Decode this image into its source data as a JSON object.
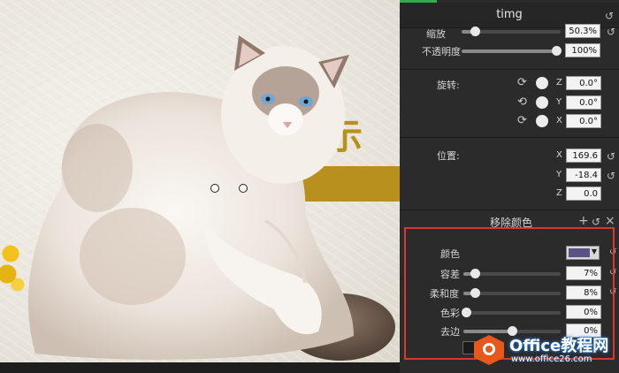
{
  "panel": {
    "title": "timg",
    "scale": {
      "label": "缩放",
      "value": "50.3%",
      "level": 0.2
    },
    "opacity": {
      "label": "不透明度",
      "value": "100%",
      "level": 1.0
    },
    "rotation": {
      "label": "旋转:",
      "z": {
        "axis": "Z",
        "value": "0.0°"
      },
      "y": {
        "axis": "Y",
        "value": "0.0°"
      },
      "x": {
        "axis": "X",
        "value": "0.0°"
      }
    },
    "position": {
      "label": "位置:",
      "x": {
        "axis": "X",
        "value": "169.6"
      },
      "y": {
        "axis": "Y",
        "value": "-18.4"
      },
      "z": {
        "axis": "Z",
        "value": "0.0"
      }
    },
    "remove_color": {
      "section_title": "移除颜色",
      "add_icon": "+",
      "close_icon": "×",
      "color": {
        "label": "颜色",
        "swatch_color": "#5c5288"
      },
      "tolerance": {
        "label": "容差",
        "value": "7%",
        "level": 0.07
      },
      "softness": {
        "label": "柔和度",
        "value": "8%",
        "level": 0.08
      },
      "hue": {
        "label": "色彩",
        "value": "0%",
        "level": 0.0
      },
      "defringe": {
        "label": "去边",
        "value": "0%",
        "level": 0.5
      }
    }
  },
  "canvas": {
    "glyph": "示"
  },
  "watermark": {
    "brand": "Office教程网",
    "site": "www.office26.com"
  },
  "colors": {
    "accent": "#38a84a",
    "highlight_border": "#d63a2f",
    "gold": "#b8901e",
    "panel_bg": "#2b2b2b"
  }
}
